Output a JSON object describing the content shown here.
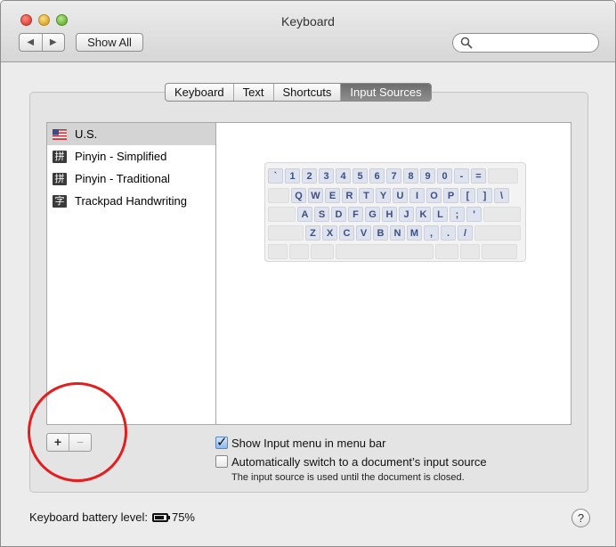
{
  "window": {
    "title": "Keyboard"
  },
  "toolbar": {
    "back_icon": "◀",
    "forward_icon": "▶",
    "show_all_label": "Show All",
    "search_value": ""
  },
  "tabs": [
    {
      "label": "Keyboard",
      "active": false
    },
    {
      "label": "Text",
      "active": false
    },
    {
      "label": "Shortcuts",
      "active": false
    },
    {
      "label": "Input Sources",
      "active": true
    }
  ],
  "input_sources": [
    {
      "label": "U.S.",
      "icon": "us-flag-icon",
      "selected": true
    },
    {
      "label": "Pinyin - Simplified",
      "icon": "pinyin-icon",
      "glyph": "拼",
      "selected": false
    },
    {
      "label": "Pinyin - Traditional",
      "icon": "pinyin-icon",
      "glyph": "拼",
      "selected": false
    },
    {
      "label": "Trackpad Handwriting",
      "icon": "handwriting-icon",
      "glyph": "字",
      "selected": false
    }
  ],
  "keyboard_layout": {
    "rows": [
      [
        "`",
        "1",
        "2",
        "3",
        "4",
        "5",
        "6",
        "7",
        "8",
        "9",
        "0",
        "-",
        "="
      ],
      [
        "Q",
        "W",
        "E",
        "R",
        "T",
        "Y",
        "U",
        "I",
        "O",
        "P",
        "[",
        "]",
        "\\"
      ],
      [
        "A",
        "S",
        "D",
        "F",
        "G",
        "H",
        "J",
        "K",
        "L",
        ";",
        "'"
      ],
      [
        "Z",
        "X",
        "C",
        "V",
        "B",
        "N",
        "M",
        ",",
        ".",
        "/"
      ]
    ]
  },
  "list_controls": {
    "add_label": "+",
    "remove_label": "−"
  },
  "options": {
    "show_input_menu": {
      "label": "Show Input menu in menu bar",
      "checked": true
    },
    "auto_switch": {
      "label": "Automatically switch to a document’s input source",
      "checked": false
    },
    "note": "The input source is used until the document is closed."
  },
  "footer": {
    "battery_label": "Keyboard battery level:",
    "battery_value": "75%",
    "help_label": "?"
  },
  "colors": {
    "annotation_circle": "#e21e1e",
    "selected_tab": "#7a7a7a",
    "key_text": "#3d4f82"
  }
}
